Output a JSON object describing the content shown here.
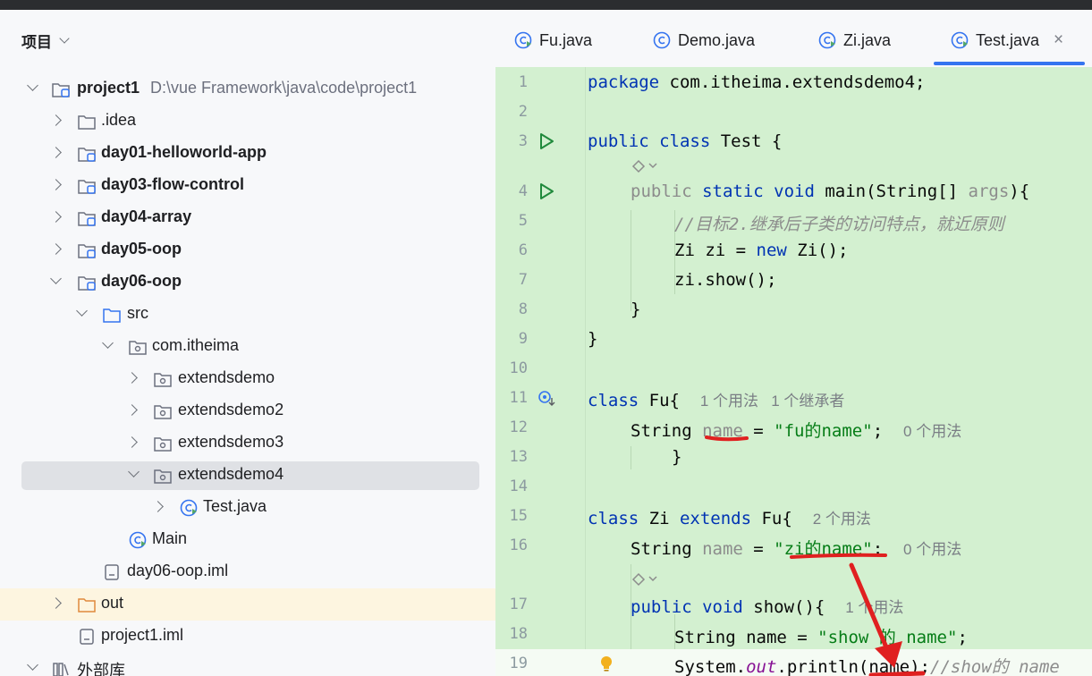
{
  "panel": {
    "title": "项目",
    "tree": [
      {
        "label": "project1",
        "path": "D:\\vue  Framework\\java\\code\\project1"
      },
      {
        "label": ".idea"
      },
      {
        "label": "day01-helloworld-app"
      },
      {
        "label": "day03-flow-control"
      },
      {
        "label": "day04-array"
      },
      {
        "label": "day05-oop"
      },
      {
        "label": "day06-oop"
      },
      {
        "label": "src"
      },
      {
        "label": "com.itheima"
      },
      {
        "label": "extendsdemo"
      },
      {
        "label": "extendsdemo2"
      },
      {
        "label": "extendsdemo3"
      },
      {
        "label": "extendsdemo4"
      },
      {
        "label": "Test.java"
      },
      {
        "label": "Main"
      },
      {
        "label": "day06-oop.iml"
      },
      {
        "label": "out"
      },
      {
        "label": "project1.iml"
      },
      {
        "label": "外部库"
      }
    ]
  },
  "tabs": [
    {
      "label": "Fu.java"
    },
    {
      "label": "Demo.java"
    },
    {
      "label": "Zi.java"
    },
    {
      "label": "Test.java",
      "active": true,
      "close": "×"
    }
  ],
  "code": {
    "line_numbers": [
      "1",
      "2",
      "3",
      "4",
      "5",
      "6",
      "7",
      "8",
      "9",
      "10",
      "11",
      "12",
      "13",
      "14",
      "15",
      "16",
      "17",
      "18",
      "19"
    ],
    "l1": {
      "kw": "package",
      "rest": " com.itheima.extendsdemo4;"
    },
    "l3": {
      "kw": "public class",
      "rest": " Test {"
    },
    "l4": {
      "pub": "public",
      "kw": " static void",
      "m": " main(String[] ",
      "par": "args",
      "end": "){"
    },
    "l5": {
      "cmt": "//目标2.继承后子类的访问特点，就近原则"
    },
    "l6": {
      "a": "Zi zi = ",
      "kw": "new",
      "b": " Zi();"
    },
    "l7": {
      "a": "zi.show();"
    },
    "l8": {
      "a": "}"
    },
    "l9": {
      "a": "}"
    },
    "l11": {
      "kw": "class",
      "a": " Fu{",
      "hint": "1 个用法   1 个继承者"
    },
    "l12": {
      "a": "String ",
      "name": "name",
      "b": " = ",
      "str": "\"fu的name\"",
      "c": ";",
      "hint": "0 个用法"
    },
    "l13": {
      "a": "}"
    },
    "l15": {
      "kw": "class",
      "a": " Zi ",
      "kw2": "extends",
      "b": " Fu{",
      "hint": "2 个用法"
    },
    "l16": {
      "a": "String ",
      "name": "name",
      "b": " = ",
      "str": "\"zi的name\"",
      "c": ";",
      "hint": "0 个用法"
    },
    "l17": {
      "kw": "public void",
      "a": " show(){",
      "hint": "1 个用法"
    },
    "l18": {
      "a": "String name = ",
      "str": "\"show 的 name\"",
      "c": ";"
    },
    "l19": {
      "a": "System.",
      "fld": "out",
      "b": ".println(name);",
      "cmt": "//show的 name"
    }
  },
  "colors": {
    "code_bg": "#d3f0d0",
    "keyword": "#0033b3",
    "string": "#067d17",
    "annotation_red": "#e02020",
    "tab_underline": "#3574f0"
  }
}
